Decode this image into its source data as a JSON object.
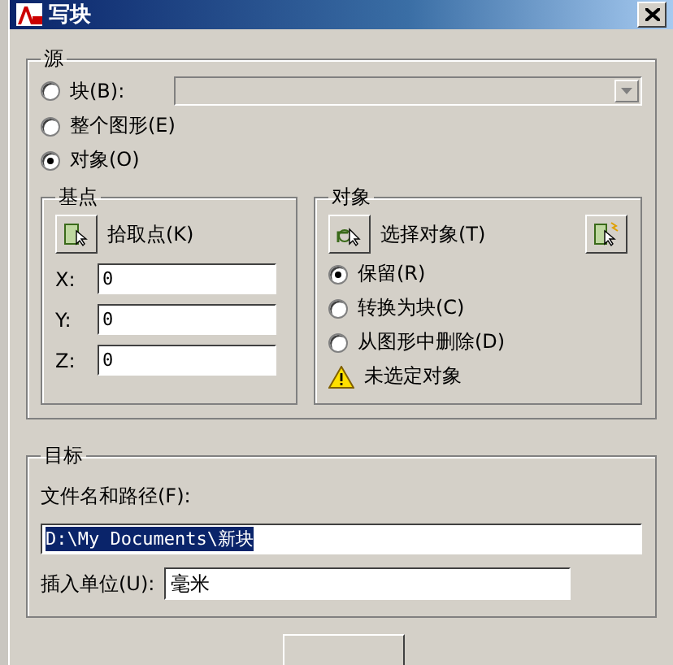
{
  "window": {
    "title": "写块"
  },
  "source": {
    "label": "源",
    "options": [
      {
        "label": "块(B):",
        "selected": false
      },
      {
        "label": "整个图形(E)",
        "selected": false
      },
      {
        "label": "对象(O)",
        "selected": true
      }
    ],
    "block_dropdown": {
      "disabled": true
    }
  },
  "base_point": {
    "label": "基点",
    "pick_button": "拾取点(K)",
    "coords": [
      {
        "label": "X:",
        "value": "0"
      },
      {
        "label": "Y:",
        "value": "0"
      },
      {
        "label": "Z:",
        "value": "0"
      }
    ]
  },
  "objects": {
    "label": "对象",
    "select_button": "选择对象(T)",
    "options": [
      {
        "label": "保留(R)",
        "selected": true
      },
      {
        "label": "转换为块(C)",
        "selected": false
      },
      {
        "label": "从图形中删除(D)",
        "selected": false
      }
    ],
    "warning": "未选定对象"
  },
  "target": {
    "label": "目标",
    "file_label": "文件名和路径(F):",
    "file_value": "D:\\My Documents\\新块",
    "file_value_highlighted": true,
    "units_label": "插入单位(U):",
    "units_value": "毫米"
  }
}
